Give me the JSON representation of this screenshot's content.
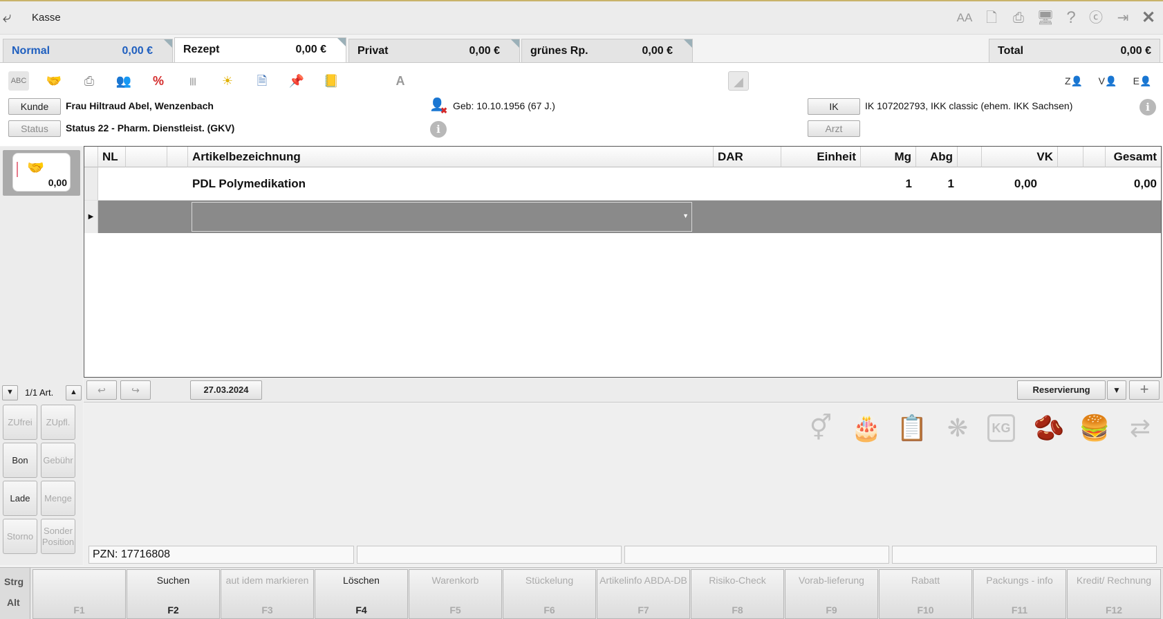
{
  "window": {
    "title": "Kasse"
  },
  "title_icons": [
    "font-size-icon",
    "copy-icon",
    "print-icon",
    "monitor-icon",
    "help-icon",
    "edge-icon",
    "exit-icon",
    "close-icon"
  ],
  "tabs": [
    {
      "label": "Normal",
      "value": "0,00 €",
      "active": false,
      "accent": "#1f5fbf"
    },
    {
      "label": "Rezept",
      "value": "0,00 €",
      "active": true
    },
    {
      "label": "Privat",
      "value": "0,00 €",
      "active": false
    },
    {
      "label": "grünes Rp.",
      "value": "0,00 €",
      "active": false
    }
  ],
  "total": {
    "label": "Total",
    "value": "0,00 €"
  },
  "customer": {
    "kunde_btn": "Kunde",
    "name": "Frau Hiltraud Abel, Wenzenbach",
    "status_btn": "Status",
    "status": "Status 22 - Pharm. Dienstleist. (GKV)",
    "birth": "Geb: 10.10.1956 (67 J.)",
    "ik_btn": "IK",
    "ik": "IK 107202793, IKK classic (ehem. IKK Sachsen)",
    "arzt_btn": "Arzt"
  },
  "right_icons": [
    {
      "letter": "Z"
    },
    {
      "letter": "V"
    },
    {
      "letter": "E"
    }
  ],
  "sale": {
    "value": "0,00"
  },
  "grid": {
    "headers": {
      "nl": "NL",
      "name": "Artikelbezeichnung",
      "dar": "DAR",
      "einheit": "Einheit",
      "mg": "Mg",
      "abg": "Abg",
      "vk": "VK",
      "gesamt": "Gesamt"
    },
    "rows": [
      {
        "name": "PDL Polymedikation",
        "mg": "1",
        "abg": "1",
        "vk": "0,00",
        "gesamt": "0,00"
      }
    ]
  },
  "nav": {
    "count": "1/1 Art."
  },
  "date": "27.03.2024",
  "reservierung": "Reservierung",
  "side_buttons": [
    {
      "label": "ZUfrei",
      "enabled": false
    },
    {
      "label": "ZUpfl.",
      "enabled": false
    },
    {
      "label": "Bon",
      "enabled": true
    },
    {
      "label": "Gebühr",
      "enabled": false
    },
    {
      "label": "Lade",
      "enabled": true
    },
    {
      "label": "Menge",
      "enabled": false
    },
    {
      "label": "Storno",
      "enabled": false
    },
    {
      "label": "Sonder Position",
      "enabled": false
    }
  ],
  "pzn": "PZN: 17716808",
  "modifiers": {
    "strg": "Strg",
    "alt": "Alt"
  },
  "fkeys": [
    {
      "label": "",
      "key": "F1",
      "enabled": false
    },
    {
      "label": "Suchen",
      "key": "F2",
      "enabled": true
    },
    {
      "label": "aut idem markieren",
      "key": "F3",
      "enabled": false
    },
    {
      "label": "Löschen",
      "key": "F4",
      "enabled": true
    },
    {
      "label": "Warenkorb",
      "key": "F5",
      "enabled": false
    },
    {
      "label": "Stückelung",
      "key": "F6",
      "enabled": false
    },
    {
      "label": "Artikelinfo ABDA-DB",
      "key": "F7",
      "enabled": false
    },
    {
      "label": "Risiko-Check",
      "key": "F8",
      "enabled": false
    },
    {
      "label": "Vorab-lieferung",
      "key": "F9",
      "enabled": false
    },
    {
      "label": "Rabatt",
      "key": "F10",
      "enabled": false
    },
    {
      "label": "Packungs - info",
      "key": "F11",
      "enabled": false
    },
    {
      "label": "Kredit/ Rechnung",
      "key": "F12",
      "enabled": false
    }
  ]
}
